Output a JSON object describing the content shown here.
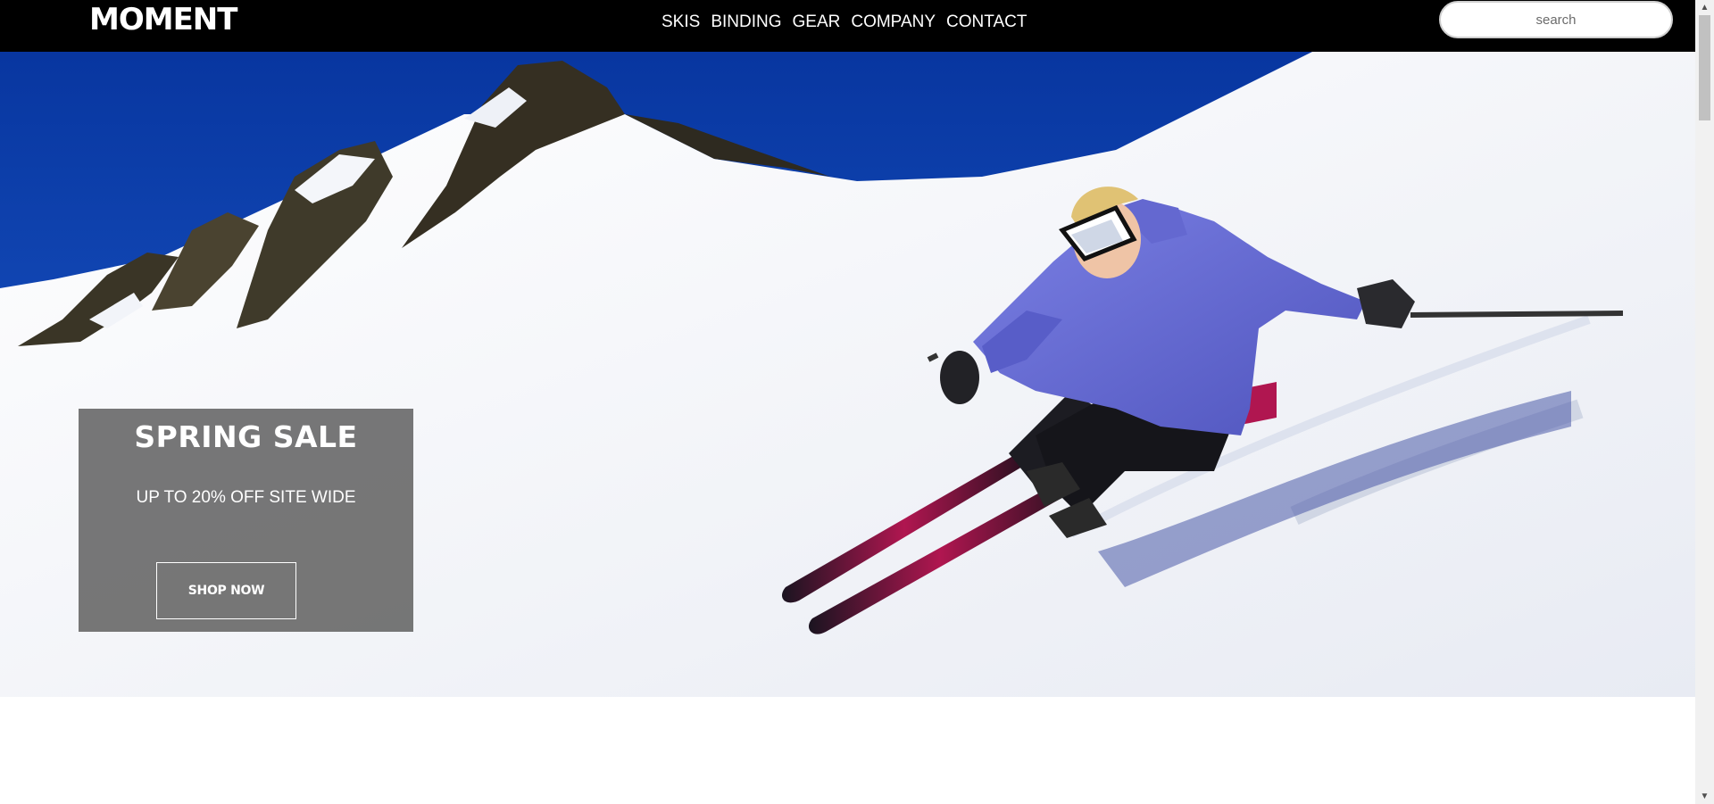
{
  "header": {
    "logo": "MOMENT",
    "nav": [
      {
        "label": "SKIS"
      },
      {
        "label": "BINDING"
      },
      {
        "label": "GEAR"
      },
      {
        "label": "COMPANY"
      },
      {
        "label": "CONTACT"
      }
    ],
    "search_placeholder": "search"
  },
  "hero": {
    "promo_title": "SPRING SALE",
    "promo_subtitle": "UP TO 20% OFF SITE WIDE",
    "promo_button": "SHOP NOW"
  },
  "scrollbar": {
    "up_icon": "▲",
    "down_icon": "▼"
  },
  "colors": {
    "header_bg": "#000000",
    "sky": "#0b3ea8",
    "jacket": "#6a70d6",
    "promo_bg": "#5f5f5f"
  }
}
